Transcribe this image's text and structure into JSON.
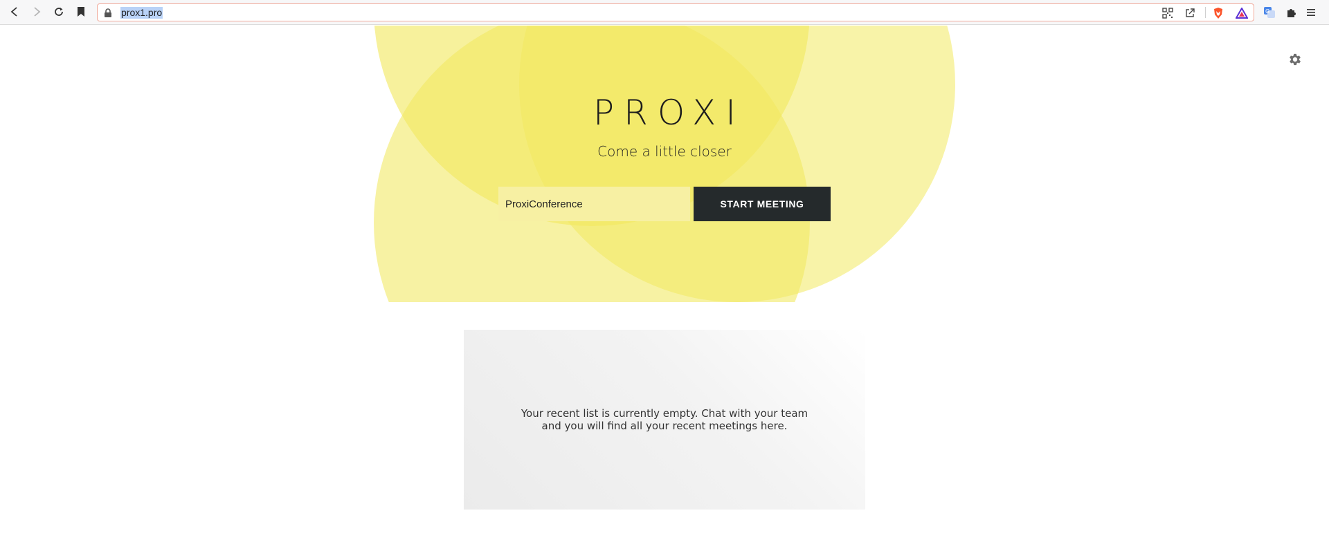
{
  "browser": {
    "url": "prox1.pro",
    "icons": {
      "back": "back-arrow-icon",
      "forward": "forward-arrow-icon",
      "reload": "reload-icon",
      "bookmark": "bookmark-icon",
      "lock": "lock-icon",
      "qr": "qr-code-icon",
      "share": "external-link-icon",
      "brave": "brave-shield-icon",
      "rewards": "brave-rewards-icon",
      "translate": "translate-icon",
      "extensions": "puzzle-piece-icon",
      "menu": "hamburger-menu-icon"
    }
  },
  "app": {
    "brand": "PROXI",
    "tagline": "Come a little closer",
    "room_value": "ProxiConference",
    "start_button": "START MEETING",
    "recent_empty": "Your recent list is currently empty. Chat with your team and you will find all your recent meetings here.",
    "settings_icon": "gear-icon"
  },
  "colors": {
    "accent_yellow": "#f5ee7a",
    "button_dark": "#252a2c"
  }
}
